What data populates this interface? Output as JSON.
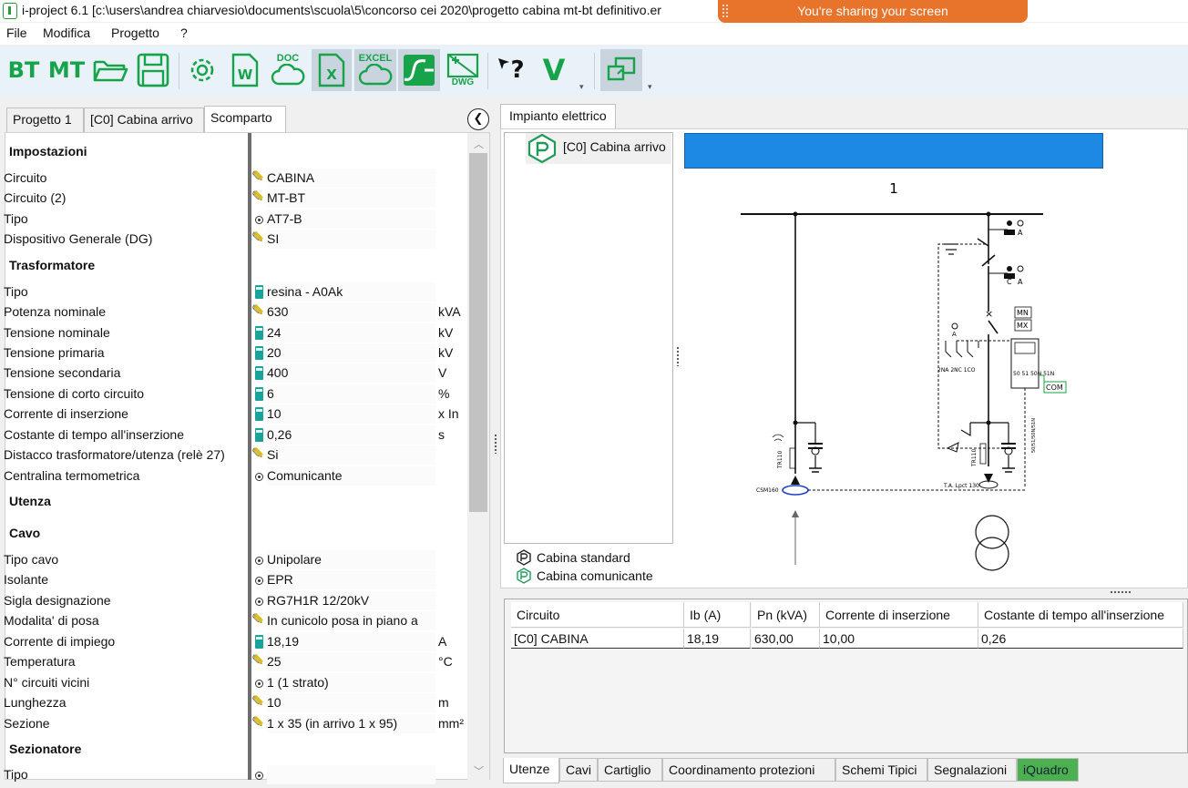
{
  "window": {
    "title": "i-project 6.1 [c:\\users\\andrea chiarvesio\\documents\\scuola\\5\\concorso cei 2020\\progetto cabina mt-bt definitivo.er",
    "sharing_banner": "You're sharing your screen"
  },
  "menu": [
    "File",
    "Modifica",
    "Progetto",
    "?"
  ],
  "toolbar": {
    "bt_label": "BT",
    "mt_label": "MT",
    "doc_label": "DOC",
    "excel_label": "EXCEL",
    "dwg_label": "DWG",
    "help_label": "?",
    "verify_label": "V"
  },
  "left_tabs": [
    "Progetto 1",
    "[C0] Cabina arrivo",
    "Scomparto"
  ],
  "properties": {
    "impostazioni": {
      "title": "Impostazioni",
      "rows": [
        {
          "label": "Circuito",
          "icon": "pencil-icon",
          "value": "CABINA",
          "unit": ""
        },
        {
          "label": "Circuito (2)",
          "icon": "pencil-icon",
          "value": "MT-BT",
          "unit": ""
        },
        {
          "label": "Tipo",
          "icon": "radio-icon",
          "value": "AT7-B",
          "unit": ""
        },
        {
          "label": "Dispositivo Generale (DG)",
          "icon": "pencil-icon",
          "value": "SI",
          "unit": ""
        }
      ]
    },
    "trasformatore": {
      "title": "Trasformatore",
      "rows": [
        {
          "label": "Tipo",
          "icon": "calculator-icon",
          "value": "resina - A0Ak",
          "unit": ""
        },
        {
          "label": "Potenza nominale",
          "icon": "pencil-icon",
          "value": "630",
          "unit": "kVA"
        },
        {
          "label": "Tensione nominale",
          "icon": "calculator-icon",
          "value": "24",
          "unit": "kV"
        },
        {
          "label": "Tensione primaria",
          "icon": "calculator-icon",
          "value": "20",
          "unit": "kV"
        },
        {
          "label": "Tensione secondaria",
          "icon": "calculator-icon",
          "value": "400",
          "unit": "V"
        },
        {
          "label": "Tensione di corto circuito",
          "icon": "calculator-icon",
          "value": "6",
          "unit": "%"
        },
        {
          "label": "Corrente di inserzione",
          "icon": "calculator-icon",
          "value": "10",
          "unit": "x In"
        },
        {
          "label": "Costante di tempo all'inserzione",
          "icon": "calculator-icon",
          "value": "0,26",
          "unit": "s"
        },
        {
          "label": "Distacco trasformatore/utenza (relè 27)",
          "icon": "pencil-icon",
          "value": "Si",
          "unit": ""
        },
        {
          "label": "Centralina termometrica",
          "icon": "radio-icon",
          "value": "Comunicante",
          "unit": ""
        }
      ]
    },
    "utenza": {
      "title": "Utenza"
    },
    "cavo": {
      "title": "Cavo",
      "rows": [
        {
          "label": "Tipo cavo",
          "icon": "radio-icon",
          "value": "Unipolare",
          "unit": ""
        },
        {
          "label": "Isolante",
          "icon": "radio-icon",
          "value": "EPR",
          "unit": ""
        },
        {
          "label": "Sigla designazione",
          "icon": "radio-icon",
          "value": "RG7H1R 12/20kV",
          "unit": ""
        },
        {
          "label": "Modalita' di posa",
          "icon": "pencil-icon",
          "value": "In cunicolo posa in piano a",
          "unit": ""
        },
        {
          "label": "Corrente di impiego",
          "icon": "calculator-icon",
          "value": "18,19",
          "unit": "A"
        },
        {
          "label": "Temperatura",
          "icon": "pencil-icon",
          "value": "25",
          "unit": "°C"
        },
        {
          "label": "N° circuiti vicini",
          "icon": "radio-icon",
          "value": "1 (1 strato)",
          "unit": ""
        },
        {
          "label": "Lunghezza",
          "icon": "pencil-icon",
          "value": "10",
          "unit": "m"
        },
        {
          "label": "Sezione",
          "icon": "pencil-icon",
          "value": "1 x 35 (in arrivo 1 x 95)",
          "unit": "mm²"
        }
      ]
    },
    "sezionatore": {
      "title": "Sezionatore",
      "rows": [
        {
          "label": "Tipo",
          "icon": "radio-icon",
          "value": "",
          "unit": ""
        }
      ]
    }
  },
  "right": {
    "tab": "Impianto elettrico",
    "tree_item": "[C0] Cabina arrivo",
    "legend": [
      "Cabina standard",
      "Cabina comunicante"
    ],
    "schema_number": "1",
    "schema_labels": {
      "c1": "C",
      "a1": "A",
      "c2": "C",
      "a2": "A",
      "mn": "MN",
      "mx": "MX",
      "com": "COM",
      "aux": "2NA  2NC  1CO",
      "relay": "50  51  50N 51N",
      "tr_left": "TR110",
      "tr_right": "TR110",
      "csm": "CSM160",
      "ta": "T.A. Lpct 130",
      "side": "50/51/50N/51N"
    }
  },
  "grid": {
    "headers": [
      "Circuito",
      "Ib (A)",
      "Pn (kVA)",
      "Corrente di inserzione",
      "Costante di tempo all'inserzione"
    ],
    "rows": [
      [
        "[C0] CABINA",
        "18,19",
        "630,00",
        "10,00",
        "0,26"
      ]
    ]
  },
  "bottom_tabs": [
    "Utenze",
    "Cavi",
    "Cartiglio",
    "Coordinamento protezioni",
    "Schemi Tipici",
    "Segnalazioni",
    "iQuadro"
  ],
  "colors": {
    "accent_green": "#16a34a",
    "share_orange": "#e8732a",
    "schema_blue": "#1e88e5",
    "iquadro_green": "#4caf50"
  }
}
